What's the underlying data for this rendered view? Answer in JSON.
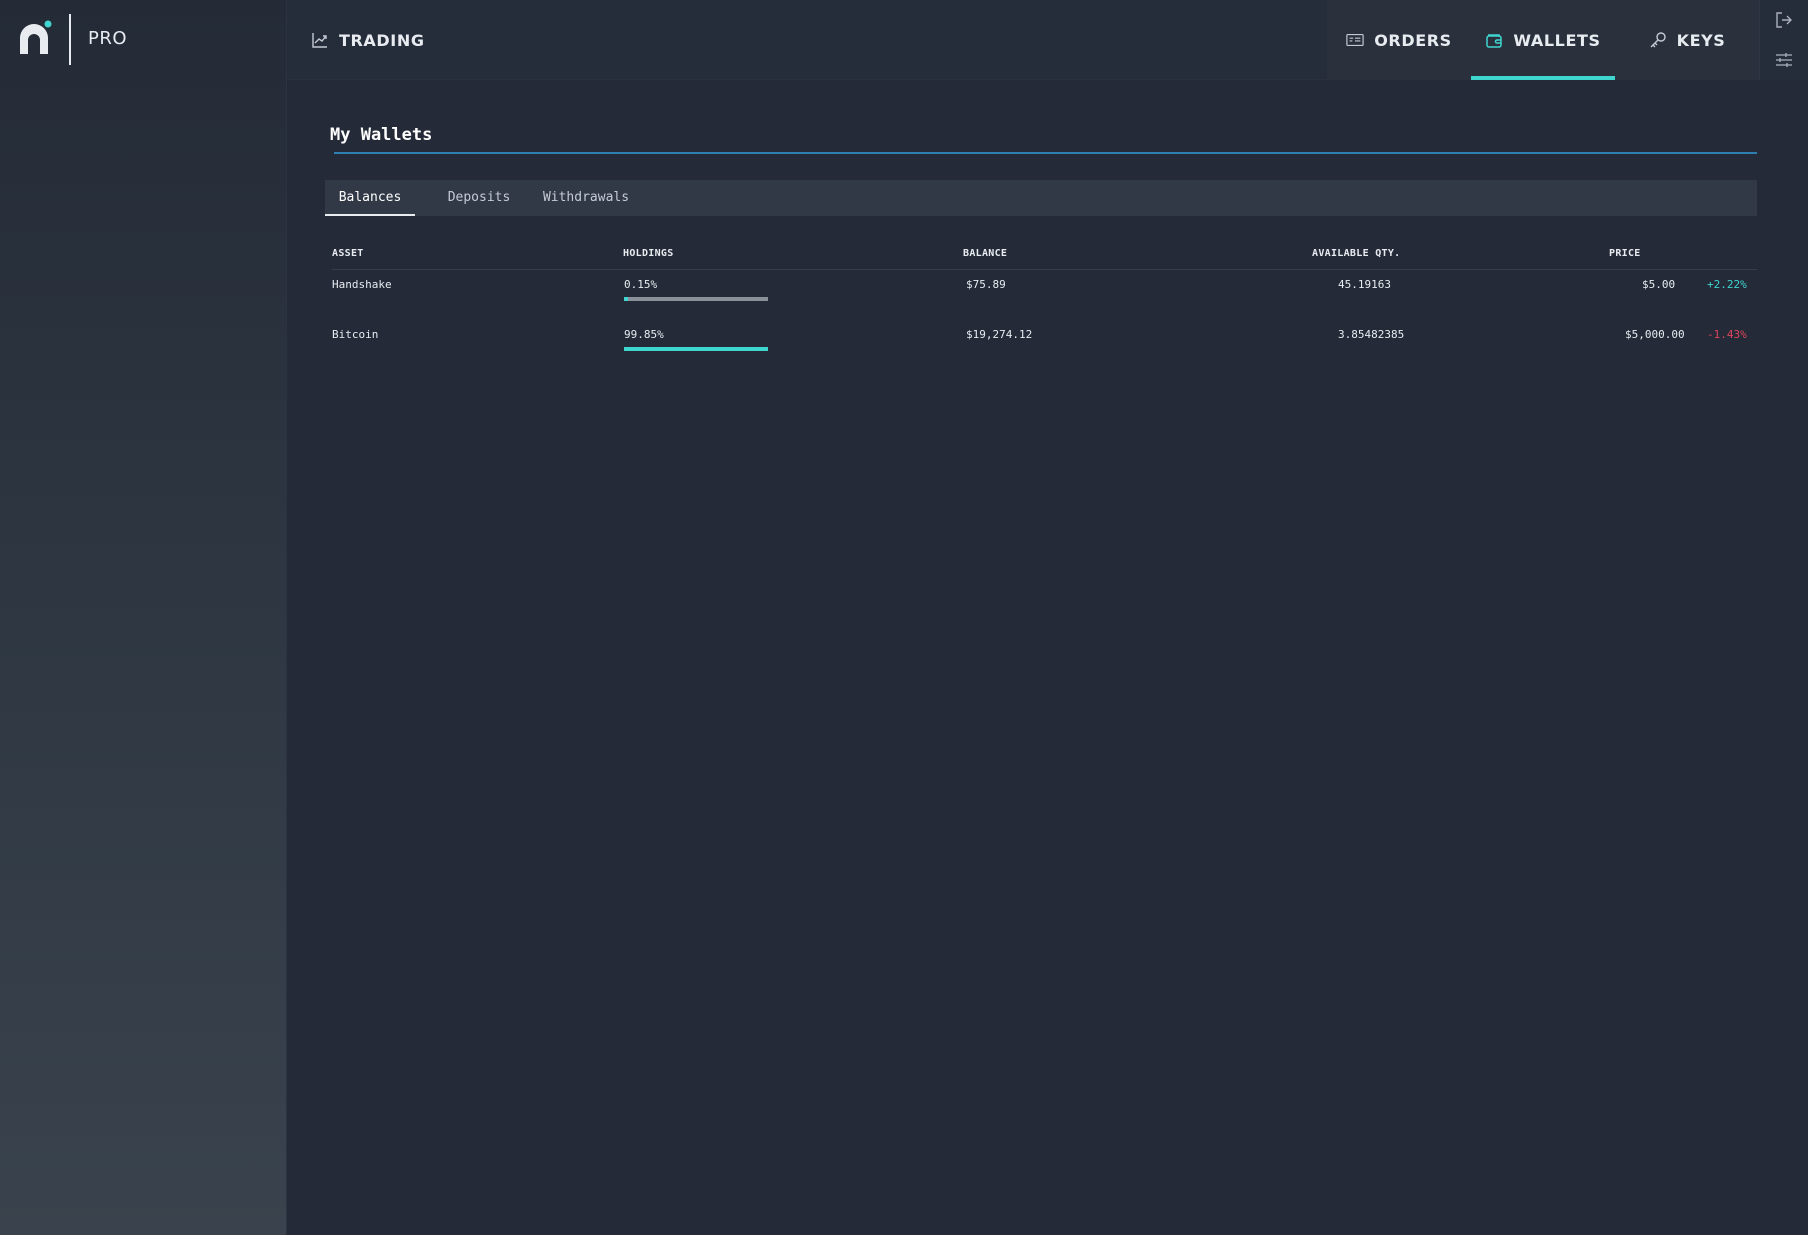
{
  "brand": {
    "name": "PRO"
  },
  "nav": {
    "trading": "TRADING",
    "orders": "ORDERS",
    "wallets": "WALLETS",
    "keys": "KEYS",
    "active": "wallets"
  },
  "page": {
    "title": "My Wallets"
  },
  "tabs": [
    "Balances",
    "Deposits",
    "Withdrawals"
  ],
  "table": {
    "headers": [
      "ASSET",
      "HOLDINGS",
      "BALANCE",
      "AVAILABLE QTY.",
      "PRICE"
    ],
    "rows": [
      {
        "asset": "Handshake",
        "holdings": "0.15%",
        "holdings_fraction": 0.0015,
        "balance": "$75.89",
        "available": "45.19163",
        "price": "$5.00",
        "change": "+2.22%"
      },
      {
        "asset": "Bitcoin",
        "holdings": "99.85%",
        "holdings_fraction": 0.9985,
        "balance": "$19,274.12",
        "available": "3.85482385",
        "price": "$5,000.00",
        "change": "-1.43%"
      }
    ]
  },
  "colors": {
    "accent": "#3fd6d0",
    "positive": "#3fd6d0",
    "negative": "#e0455b",
    "title_line": "#2f7fb0"
  },
  "icons": [
    "logo-icon",
    "chart-line-icon",
    "ticket-icon",
    "wallet-icon",
    "key-icon",
    "logout-icon",
    "sliders-icon"
  ]
}
